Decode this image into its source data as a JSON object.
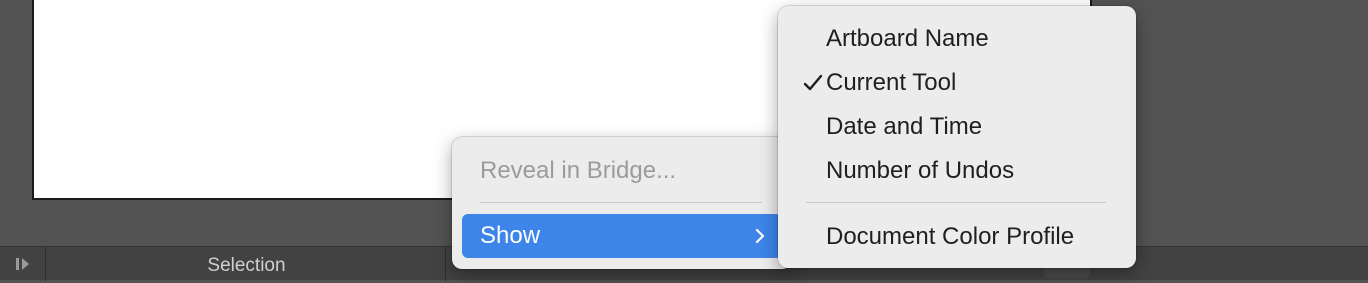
{
  "status_bar": {
    "current_tool_label": "Selection",
    "play_icon": "play-step-icon",
    "arrow_icon": "triangle-right-icon"
  },
  "context_menu": {
    "items": [
      {
        "label": "Reveal in Bridge...",
        "enabled": false
      },
      {
        "label": "Show",
        "enabled": true,
        "highlighted": true,
        "has_submenu": true
      }
    ],
    "chevron_icon": "chevron-right-icon"
  },
  "show_submenu": {
    "items": [
      {
        "label": "Artboard Name",
        "checked": false
      },
      {
        "label": "Current Tool",
        "checked": true
      },
      {
        "label": "Date and Time",
        "checked": false
      },
      {
        "label": "Number of Undos",
        "checked": false
      },
      {
        "label": "Document Color Profile",
        "checked": false
      }
    ],
    "check_icon": "checkmark-icon"
  },
  "colors": {
    "workspace": "#535353",
    "menu_background": "#ececec",
    "highlight": "#3d85e8",
    "status_bar": "#424242"
  }
}
